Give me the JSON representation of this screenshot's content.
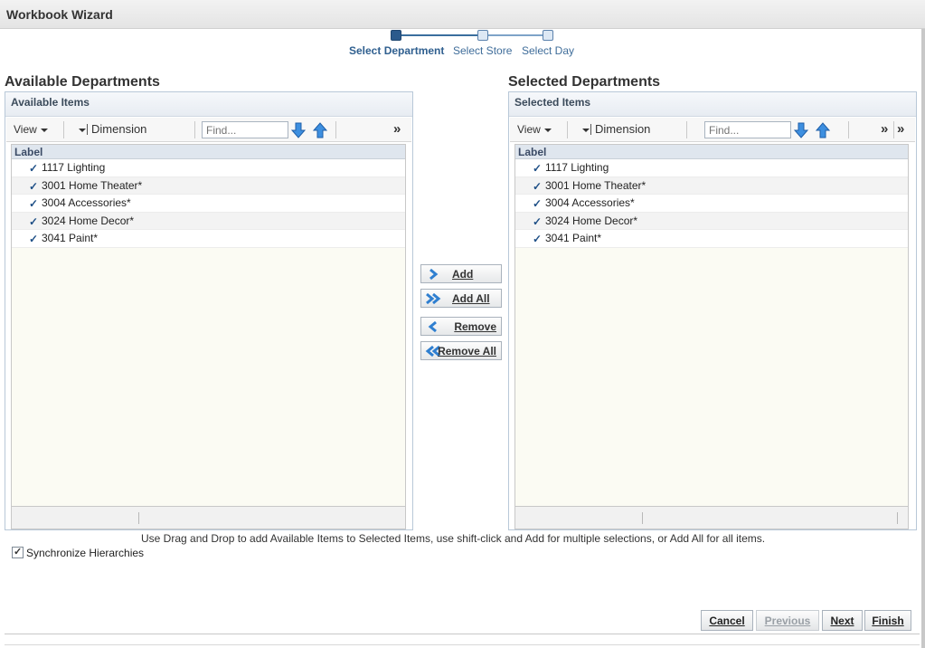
{
  "window": {
    "title": "Workbook Wizard"
  },
  "train": {
    "steps": [
      {
        "label": "Select Department",
        "active": true
      },
      {
        "label": "Select Store",
        "active": false
      },
      {
        "label": "Select Day",
        "active": false
      }
    ]
  },
  "available": {
    "section_title": "Available Departments",
    "panel_title": "Available Items",
    "toolbar": {
      "view_label": "View",
      "dimension_label": "Dimension",
      "find_placeholder": "Find...",
      "more": "»"
    },
    "column_header": "Label",
    "items": [
      "1117 Lighting",
      "3001 Home Theater*",
      "3004 Accessories*",
      "3024 Home Decor*",
      "3041 Paint*"
    ]
  },
  "selected": {
    "section_title": "Selected Departments",
    "panel_title": "Selected Items",
    "toolbar": {
      "view_label": "View",
      "dimension_label": "Dimension",
      "find_placeholder": "Find...",
      "more": "»",
      "more2": "»"
    },
    "column_header": "Label",
    "items": [
      "1117 Lighting",
      "3001 Home Theater*",
      "3004 Accessories*",
      "3024 Home Decor*",
      "3041 Paint*"
    ]
  },
  "shuttle": {
    "add": "Add",
    "add_all": "Add All",
    "remove": "Remove",
    "remove_all": "Remove All"
  },
  "hint": "Use Drag and Drop to add Available Items to Selected Items, use shift-click and Add for multiple selections, or Add All for all items.",
  "sync": {
    "label": "Synchronize Hierarchies",
    "checked": true
  },
  "buttons": {
    "cancel": "Cancel",
    "previous": "Previous",
    "next": "Next",
    "finish": "Finish"
  },
  "colors": {
    "accent": "#2b5a8c",
    "check": "#1e4f86",
    "arrow": "#2f7fd0"
  }
}
